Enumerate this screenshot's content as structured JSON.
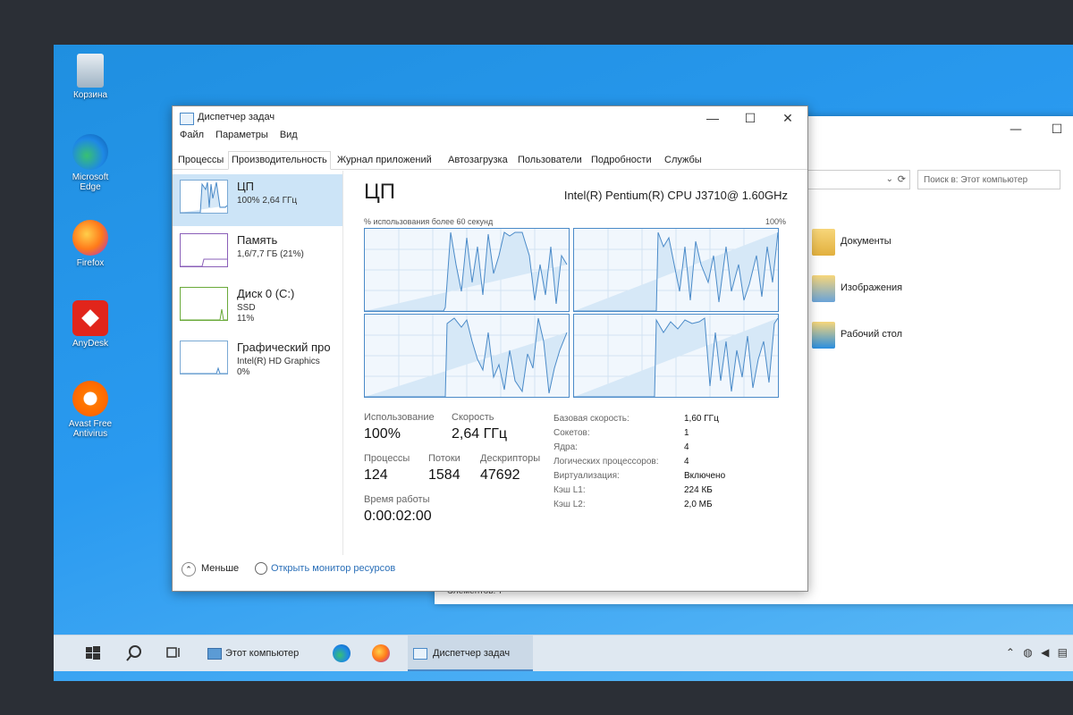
{
  "desktop": {
    "icons": [
      {
        "label": "Корзина"
      },
      {
        "label": "Microsoft Edge"
      },
      {
        "label": "Firefox"
      },
      {
        "label": "AnyDesk"
      },
      {
        "label": "Avast Free Antivirus"
      }
    ]
  },
  "explorer": {
    "search_placeholder": "Поиск в: Этот компьютер",
    "items": [
      {
        "label": "Документы"
      },
      {
        "label": "Изображения"
      },
      {
        "label": "Рабочий стол"
      }
    ],
    "status": "Элементов: 7"
  },
  "taskmanager": {
    "title": "Диспетчер задач",
    "menu": [
      "Файл",
      "Параметры",
      "Вид"
    ],
    "tabs": [
      "Процессы",
      "Производительность",
      "Журнал приложений",
      "Автозагрузка",
      "Пользователи",
      "Подробности",
      "Службы"
    ],
    "active_tab": "Производительность",
    "resources": [
      {
        "name": "ЦП",
        "line1": "100%  2,64 ГГц",
        "line2": ""
      },
      {
        "name": "Память",
        "line1": "1,6/7,7 ГБ (21%)",
        "line2": ""
      },
      {
        "name": "Диск 0 (C:)",
        "line1": "SSD",
        "line2": "11%"
      },
      {
        "name": "Графический про",
        "line1": "Intel(R) HD Graphics",
        "line2": "0%"
      }
    ],
    "cpu": {
      "title": "ЦП",
      "model": "Intel(R) Pentium(R) CPU J3710@ 1.60GHz",
      "graph_caption": "% использования более 60 секунд",
      "graph_max": "100%",
      "stats": {
        "usage_label": "Использование",
        "usage": "100%",
        "speed_label": "Скорость",
        "speed": "2,64 ГГц",
        "processes_label": "Процессы",
        "processes": "124",
        "threads_label": "Потоки",
        "threads": "1584",
        "handles_label": "Дескрипторы",
        "handles": "47692",
        "uptime_label": "Время работы",
        "uptime": "0:00:02:00"
      },
      "info": [
        {
          "label": "Базовая скорость:",
          "value": "1,60 ГГц"
        },
        {
          "label": "Сокетов:",
          "value": "1"
        },
        {
          "label": "Ядра:",
          "value": "4"
        },
        {
          "label": "Логических процессоров:",
          "value": "4"
        },
        {
          "label": "Виртуализация:",
          "value": "Включено"
        },
        {
          "label": "Кэш L1:",
          "value": "224 КБ"
        },
        {
          "label": "Кэш L2:",
          "value": "2,0 МБ"
        }
      ]
    },
    "fewer_details": "Меньше",
    "resource_monitor": "Открыть монитор ресурсов"
  },
  "taskbar": {
    "explorer_label": "Этот компьютер",
    "taskmgr_label": "Диспетчер задач"
  },
  "colors": {
    "desktop": "#2a9af0",
    "graph_line": "#4a8ac8",
    "selected_resource": "#cce4f7"
  }
}
